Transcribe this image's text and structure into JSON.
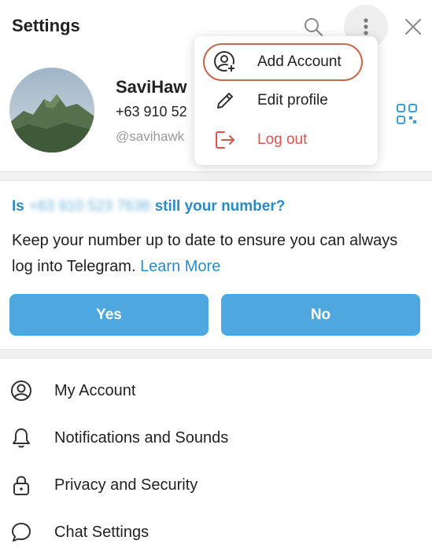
{
  "header": {
    "title": "Settings",
    "icons": [
      "search-icon",
      "more-vertical-icon",
      "close-icon"
    ]
  },
  "profile": {
    "name": "SaviHaw",
    "phone": "+63 910 52",
    "username": "@savihawk"
  },
  "verify": {
    "question_prefix": "Is",
    "number": "+63 910 523 7638",
    "question_suffix": "still your number?",
    "body": "Keep your number up to date to ensure you can always log into Telegram.",
    "learn_more": "Learn More",
    "yes_label": "Yes",
    "no_label": "No"
  },
  "menu": {
    "items": [
      {
        "label": "My Account",
        "icon": "user-circle-icon"
      },
      {
        "label": "Notifications and Sounds",
        "icon": "bell-icon"
      },
      {
        "label": "Privacy and Security",
        "icon": "lock-icon"
      },
      {
        "label": "Chat Settings",
        "icon": "chat-bubble-icon"
      }
    ]
  },
  "dropdown": {
    "items": [
      {
        "label": "Add Account",
        "icon": "add-user-icon"
      },
      {
        "label": "Edit profile",
        "icon": "pencil-icon"
      },
      {
        "label": "Log out",
        "icon": "logout-icon"
      }
    ]
  },
  "colors": {
    "accent": "#4ea8df",
    "link": "#2a8cc7",
    "danger": "#d9534f",
    "highlight_ring": "#c46a4e"
  }
}
